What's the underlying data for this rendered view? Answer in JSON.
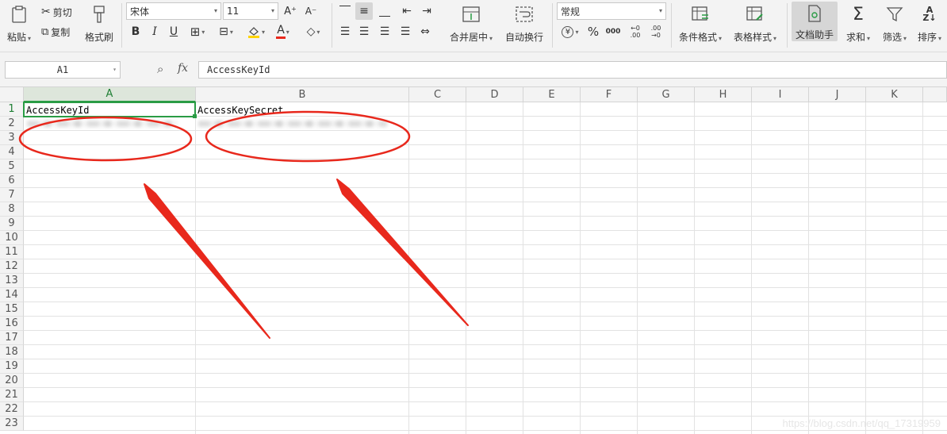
{
  "toolbar": {
    "paste": "粘贴",
    "cut": "剪切",
    "copy": "复制",
    "format_painter": "格式刷",
    "font_name": "宋体",
    "font_size": "11",
    "bold": "B",
    "italic": "I",
    "underline": "U",
    "font_grow": "A⁺",
    "font_shrink": "A⁻",
    "font_color_glyph": "A",
    "merge_center": "合并居中",
    "wrap_text": "自动换行",
    "number_format": "常规",
    "currency": "¥",
    "percent": "%",
    "thousands": "000",
    "inc_decimal": "←0 .00",
    "dec_decimal": ".00 →0",
    "conditional_format": "条件格式",
    "table_style": "表格样式",
    "doc_assistant": "文档助手",
    "sum": "求和",
    "filter": "筛选",
    "sort": "排序"
  },
  "formula_bar": {
    "name_box": "A1",
    "fx": "fx",
    "content": "AccessKeyId"
  },
  "grid": {
    "columns": [
      "A",
      "B",
      "C",
      "D",
      "E",
      "F",
      "G",
      "H",
      "I",
      "J",
      "K"
    ],
    "rows": [
      "1",
      "2",
      "3",
      "4",
      "5",
      "6",
      "7",
      "8",
      "9",
      "10",
      "11",
      "12",
      "13",
      "14",
      "15",
      "16",
      "17",
      "18",
      "19",
      "20",
      "21",
      "22",
      "23"
    ],
    "a1": "AccessKeyId",
    "b1": "AccessKeySecret",
    "selected_col": "A",
    "selected_row": "1"
  },
  "watermark": "https://blog.csdn.net/qq_17319959",
  "colors": {
    "accent_green": "#2a9c45",
    "annotation_red": "#e8281c"
  }
}
